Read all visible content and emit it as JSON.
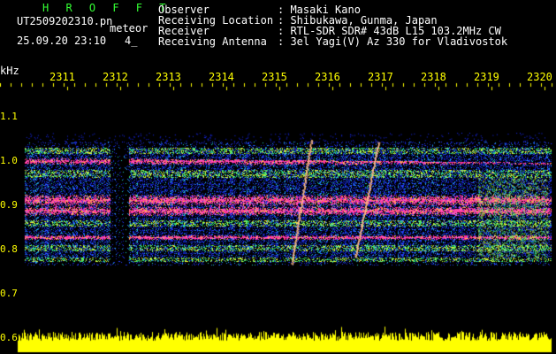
{
  "header": {
    "title": "H R O F F T",
    "file": "UT2509202310.pn",
    "meteor": "meteor",
    "datetime": "25.09.20 23:10",
    "count": "4_"
  },
  "info": {
    "observer_label": "Observer",
    "observer_value": ": Masaki Kano",
    "location_label": "Receiving Location",
    "location_value": ": Shibukawa, Gunma, Japan",
    "receiver_label": "Receiver",
    "receiver_value": ": RTL-SDR SDR# 43dB L15 103.2MHz CW",
    "antenna_label": "Receiving Antenna",
    "antenna_value": ": 3el Yagi(V) Az 330 for Vladivostok"
  },
  "axis": {
    "unit": "kHz",
    "x_ticks": [
      "2311",
      "2312",
      "2313",
      "2314",
      "2315",
      "2316",
      "2317",
      "2318",
      "2319",
      "2320"
    ],
    "y_ticks": [
      "1.1",
      "1.0",
      "0.9",
      "0.8",
      "0.7",
      "0.6"
    ]
  },
  "colors": {
    "text_primary": "#ffffff",
    "accent_yellow": "#ffff00",
    "title_green": "#33ff33",
    "band_magenta": "#ff3399",
    "noise_blue": "#1a2aff"
  }
}
